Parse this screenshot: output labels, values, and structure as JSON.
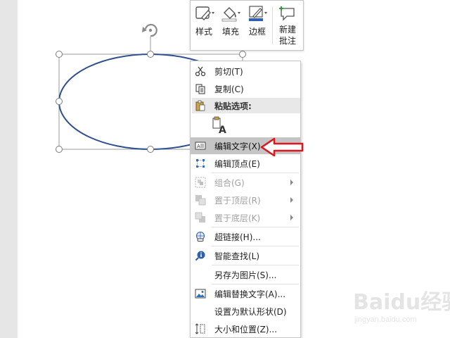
{
  "mini_toolbar": {
    "style_label": "样式",
    "fill_label": "填充",
    "border_label": "边框",
    "new_comment_line1": "新建",
    "new_comment_line2": "批注"
  },
  "context_menu": {
    "cut": "剪切(T)",
    "copy": "复制(C)",
    "paste_options_header": "粘贴选项:",
    "edit_text": "编辑文字(X)",
    "edit_points": "编辑顶点(E)",
    "group": "组合(G)",
    "bring_to_front": "置于顶层(R)",
    "send_to_back": "置于底层(K)",
    "hyperlink": "超链接(H)...",
    "smart_lookup": "智能查找(L)",
    "save_as_picture": "另存为图片(S)...",
    "edit_alt_text": "编辑替换文字(A)...",
    "set_default_shape": "设置为默认形状(D)",
    "size_and_position": "大小和位置(Z)..."
  },
  "colors": {
    "ellipse_stroke": "#2f4f8f",
    "highlight": "#c5c5c5",
    "annotation_arrow": "#e0161f"
  },
  "watermark": {
    "brand": "Baidu经验",
    "url": "jingyan.baidu.com"
  }
}
